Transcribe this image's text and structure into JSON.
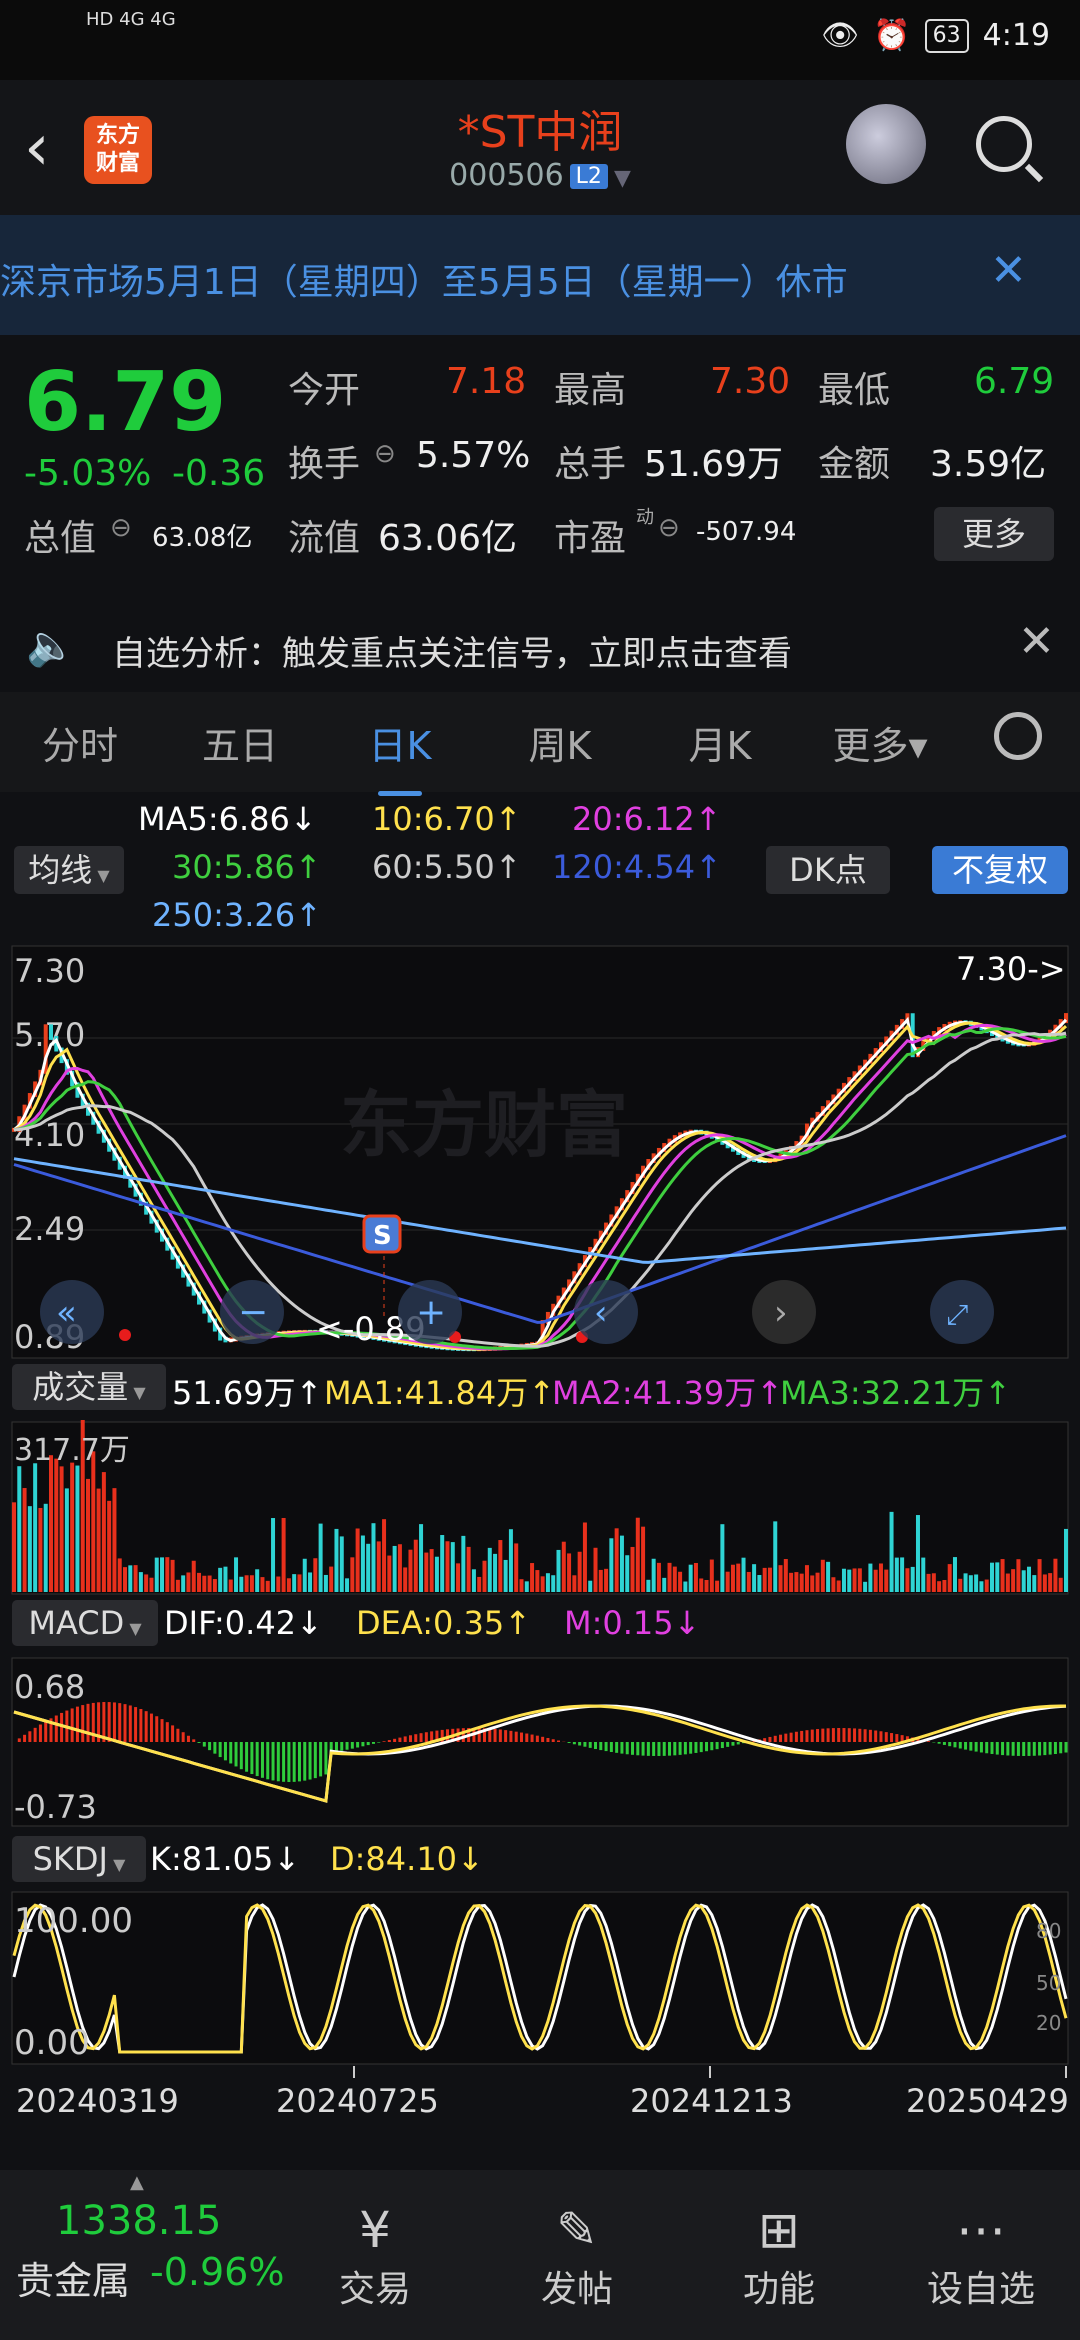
{
  "status_bar": {
    "left": "HD 4G 4G",
    "battery": "63",
    "time": "4:19"
  },
  "header": {
    "back_icon": "back-arrow-icon",
    "logo_text": "东方\n财富",
    "name": "*ST中润",
    "code": "000506",
    "level": "L2"
  },
  "notice": {
    "text": "深京市场5月1日（星期四）至5月5日（星期一）休市",
    "close": "✕"
  },
  "quote": {
    "price": "6.79",
    "change_pct": "-5.03%",
    "change_abs": "-0.36",
    "open_label": "今开",
    "open": "7.18",
    "high_label": "最高",
    "high": "7.30",
    "low_label": "最低",
    "low": "6.79",
    "turnover_label": "换手",
    "turnover": "5.57%",
    "volume_label": "总手",
    "volume": "51.69万",
    "amount_label": "金额",
    "amount": "3.59亿",
    "mcap_label": "总值",
    "mcap": "63.08亿",
    "float_label": "流值",
    "float": "63.06亿",
    "pe_label": "市盈",
    "pe_sup": "动",
    "pe": "-507.94",
    "more": "更多"
  },
  "tip": {
    "text": "自选分析：触发重点关注信号，立即点击查看"
  },
  "tabs": [
    "分时",
    "五日",
    "日K",
    "周K",
    "月K",
    "更多▾"
  ],
  "active_tab": 2,
  "ma_legend": {
    "toggle": "均线",
    "ma5": "MA5:6.86↓",
    "ma10": "10:6.70↑",
    "ma20": "20:6.12↑",
    "ma30": "30:5.86↑",
    "ma60": "60:5.50↑",
    "ma120": "120:4.54↑",
    "ma250": "250:3.26↑",
    "dk": "DK点",
    "adjust": "不复权"
  },
  "kline": {
    "y_labels": [
      "7.30",
      "5.70",
      "4.10",
      "2.49",
      "0.89"
    ],
    "high_marker": "7.30->",
    "low_marker": "<-0.89",
    "s_badge": "S"
  },
  "volume": {
    "toggle": "成交量",
    "vol": "51.69万↑",
    "ma1": "MA1:41.84万↑",
    "ma2": "MA2:41.39万↑",
    "ma3": "MA3:32.21万↑",
    "y_label": "317.7万"
  },
  "macd": {
    "toggle": "MACD",
    "dif": "DIF:0.42↓",
    "dea": "DEA:0.35↑",
    "m": "M:0.15↓",
    "y_top": "0.68",
    "y_bottom": "-0.73"
  },
  "skdj": {
    "toggle": "SKDJ",
    "k": "K:81.05↓",
    "d": "D:84.10↓",
    "y_top": "100.00",
    "y_bottom": "0.00",
    "r80": "80",
    "r50": "50",
    "r20": "20"
  },
  "dates": [
    "20240319",
    "20240725",
    "20241213",
    "20250429"
  ],
  "bottom": {
    "index_value": "1338.15",
    "index_name": "贵金属",
    "index_change": "-0.96%",
    "nav": [
      {
        "label": "交易",
        "icon": "yen-exchange-icon"
      },
      {
        "label": "发帖",
        "icon": "edit-icon"
      },
      {
        "label": "功能",
        "icon": "grid-icon"
      },
      {
        "label": "设自选",
        "icon": "more-dots-icon"
      }
    ]
  },
  "colors": {
    "up": "#e8401c",
    "down": "#1fcc3c",
    "accent": "#4a90e2",
    "ma5": "#ffffff",
    "ma10": "#ffe14d",
    "ma20": "#e040e0",
    "ma30": "#3fcf3f",
    "ma60": "#cccccc",
    "ma120": "#3b5bdb",
    "ma250": "#6fb3ff"
  }
}
